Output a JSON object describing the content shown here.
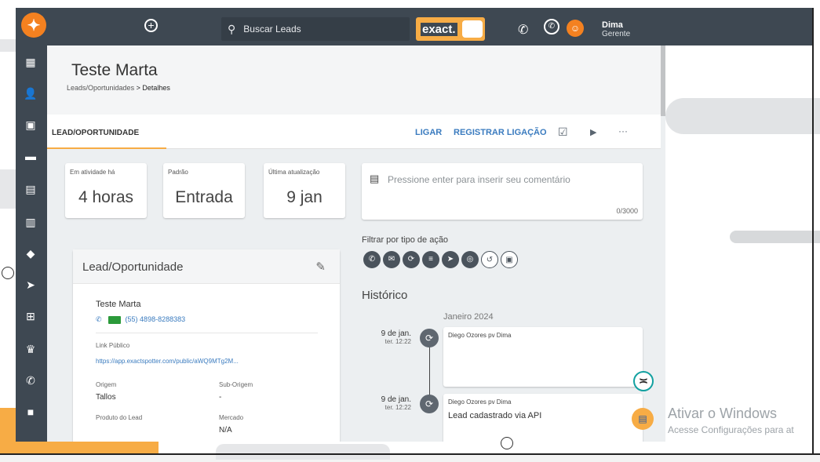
{
  "header": {
    "search_placeholder": "Buscar Leads",
    "brand": "exact.",
    "user_name": "Dima",
    "user_role": "Gerente"
  },
  "page": {
    "title": "Teste Marta",
    "breadcrumb_parent": "Leads/Oportunidades",
    "breadcrumb_sep": ">",
    "breadcrumb_current": "Detalhes"
  },
  "tabs": {
    "active": "LEAD/OPORTUNIDADE",
    "call_label": "LIGAR",
    "register_call_label": "REGISTRAR LIGAÇÃO",
    "more_label": "···"
  },
  "stats": [
    {
      "label": "Em atividade há",
      "value": "4 horas"
    },
    {
      "label": "Padrão",
      "value": "Entrada"
    },
    {
      "label": "Última atualização",
      "value": "9 jan"
    }
  ],
  "comment": {
    "placeholder": "Pressione enter para inserir seu comentário",
    "counter": "0/3000"
  },
  "filter": {
    "label": "Filtrar por tipo de ação"
  },
  "history": {
    "title": "Histórico",
    "month": "Janeiro 2024",
    "entries": [
      {
        "date": "9 de jan.",
        "time": "ter. 12:22",
        "author": "Diego Ozores pv Dima",
        "text": ""
      },
      {
        "date": "9 de jan.",
        "time": "ter. 12:22",
        "author": "Diego Ozores pv Dima",
        "text": "Lead cadastrado via API"
      }
    ]
  },
  "lead": {
    "title": "Lead/Oportunidade",
    "name": "Teste Marta",
    "phone": "(55) 4898-8288383",
    "link_label": "Link Público",
    "link": "https://app.exactspotter.com/public/aWQ9MTg2M...",
    "origin_label": "Origem",
    "origin": "Tallos",
    "suborigin_label": "Sub-Origem",
    "suborigin": "-",
    "product_label": "Produto do Lead",
    "market_label": "Mercado",
    "market": "N/A"
  },
  "windows": {
    "line1": "Ativar o Windows",
    "line2": "Acesse Configurações para at"
  },
  "colors": {
    "topbar": "#3e4852",
    "accent": "#f7ac45",
    "link": "#3a7bbf"
  }
}
